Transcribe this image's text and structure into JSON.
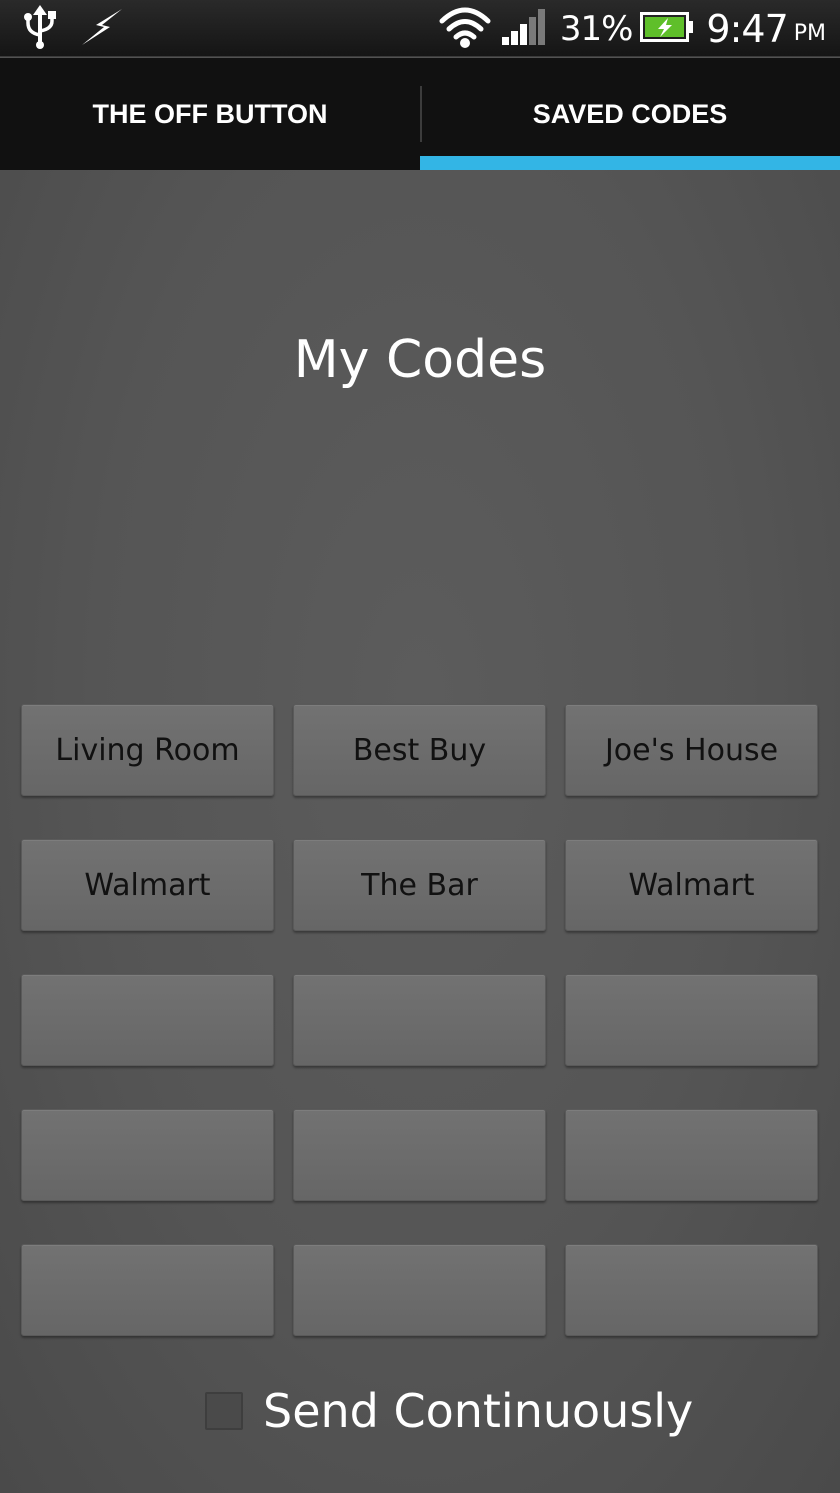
{
  "status_bar": {
    "icons": [
      "usb-icon",
      "charging-bolt-icon",
      "wifi-icon",
      "signal-icon",
      "battery-icon"
    ],
    "battery_percent": "31%",
    "time": "9:47",
    "ampm": "PM"
  },
  "tabs": [
    {
      "label": "THE OFF BUTTON",
      "selected": false
    },
    {
      "label": "SAVED CODES",
      "selected": true
    }
  ],
  "accent_color": "#33b5e5",
  "page_title": "My Codes",
  "codes": [
    "Living Room",
    "Best Buy",
    "Joe's House",
    "Walmart",
    "The Bar",
    "Walmart",
    "",
    "",
    "",
    "",
    "",
    "",
    "",
    "",
    ""
  ],
  "send_continuously": {
    "label": "Send Continuously",
    "checked": false
  }
}
